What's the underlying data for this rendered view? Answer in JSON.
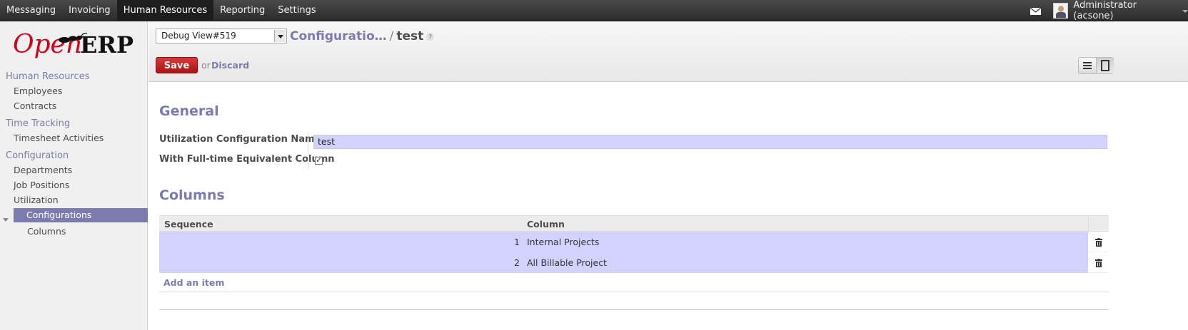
{
  "topmenu": {
    "items": [
      {
        "label": "Messaging",
        "active": false
      },
      {
        "label": "Invoicing",
        "active": false
      },
      {
        "label": "Human Resources",
        "active": true
      },
      {
        "label": "Reporting",
        "active": false
      },
      {
        "label": "Settings",
        "active": false
      }
    ],
    "user": "Administrator (acsone)"
  },
  "logo": {
    "part1": "Open",
    "part2": "ERP"
  },
  "sidebar": {
    "section_hr": "Human Resources",
    "employees": "Employees",
    "contracts": "Contracts",
    "section_time": "Time Tracking",
    "timesheet_activities": "Timesheet Activities",
    "section_config": "Configuration",
    "departments": "Departments",
    "job_positions": "Job Positions",
    "utilization": "Utilization",
    "configurations": "Configurations",
    "columns": "Columns"
  },
  "header": {
    "debug_select": "Debug View#519",
    "breadcrumb_parent": "Configuratio…",
    "breadcrumb_sep": "/",
    "breadcrumb_current": "test",
    "help": "?",
    "save": "Save",
    "or": "or",
    "discard": "Discard"
  },
  "form": {
    "general_title": "General",
    "name_label": "Utilization Configuration Name",
    "name_value": "test",
    "fte_label": "With Full-time Equivalent Column",
    "fte_checked": "✓",
    "columns_title": "Columns",
    "table": {
      "headers": [
        "Sequence",
        "Column"
      ],
      "rows": [
        {
          "sequence": "1",
          "column": "Internal Projects"
        },
        {
          "sequence": "2",
          "column": "All Billable Project"
        }
      ],
      "add_item": "Add an item"
    }
  },
  "colors": {
    "accent": "#7c7bad",
    "save": "#c22323",
    "highlight": "#d2d2ff"
  }
}
